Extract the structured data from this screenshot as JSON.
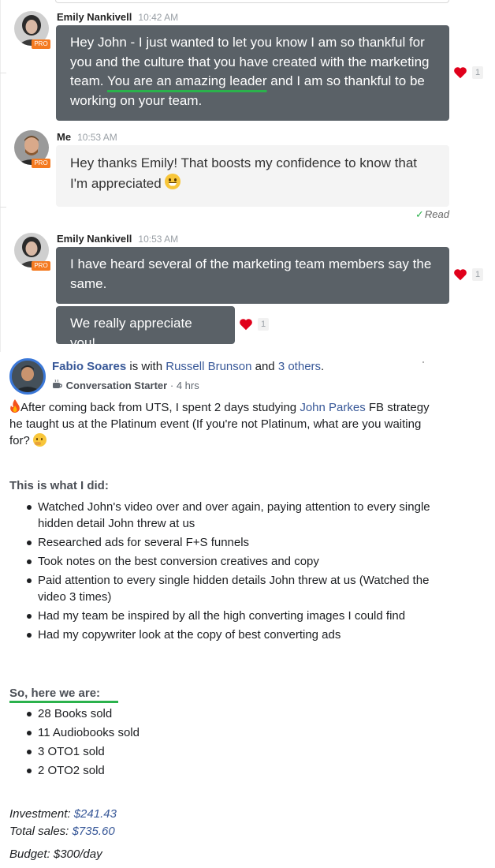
{
  "chat": {
    "messages": [
      {
        "author": "Emily Nankivell",
        "time": "10:42 AM",
        "badge": "PRO",
        "text_before": "Hey John - I just wanted to let you know I am so thankful for you and the culture that you have created with the marketing team. ",
        "text_highlight": "You are an amazing leader",
        "text_after": " and I am so thankful to be working on your team.",
        "reaction_count": "1"
      },
      {
        "author": "Me",
        "time": "10:53 AM",
        "badge": "PRO",
        "text": "Hey thanks Emily! That boosts my confidence to know that I'm appreciated",
        "status": "Read"
      },
      {
        "author": "Emily Nankivell",
        "time": "10:53 AM",
        "badge": "PRO",
        "text": "I have heard several of the marketing team members say the same.",
        "reaction_count": "1"
      },
      {
        "text": "We really appreciate you!",
        "reaction_count": "1"
      }
    ]
  },
  "post": {
    "author": "Fabio Soares",
    "is_with": "is with",
    "tagged": "Russell Brunson",
    "and": "and",
    "others": "3 others",
    "badge": "Conversation Starter",
    "time": "4 hrs",
    "intro_1": "After coming back from UTS, I spent 2 days studying ",
    "intro_link": "John Parkes",
    "intro_2": " FB strategy he taught us at the Platinum event (If you're not Platinum, what are you waiting for? ",
    "did_heading": "This is what I did:",
    "did_items": [
      "Watched John's video over and over again, paying attention to every single hidden detail John threw at us",
      "Researched ads for several F+S funnels",
      "Took notes on the best conversion creatives and copy",
      "Paid attention to every single hidden details John threw at us (Watched the video 3 times)",
      "Had my team be inspired by all the high converting images I could find",
      "Had my copywriter look at the copy of best converting ads"
    ],
    "here_heading": "So, here we are:",
    "sold_items": [
      "28 Books sold",
      "11 Audiobooks sold",
      "3 OTO1  sold",
      "2 OTO2 sold"
    ],
    "investment_label": "Investment:",
    "investment_value": "$241.43",
    "sales_label": "Total sales:",
    "sales_value": "$735.60",
    "budget": "Budget: $300/day"
  },
  "colors": {
    "dark_bubble": "#5a6167",
    "light_bubble": "#f4f4f4",
    "pro_badge": "#f47a20",
    "heart": "#e0001b",
    "link": "#385898",
    "highlight": "#2bb24c"
  }
}
